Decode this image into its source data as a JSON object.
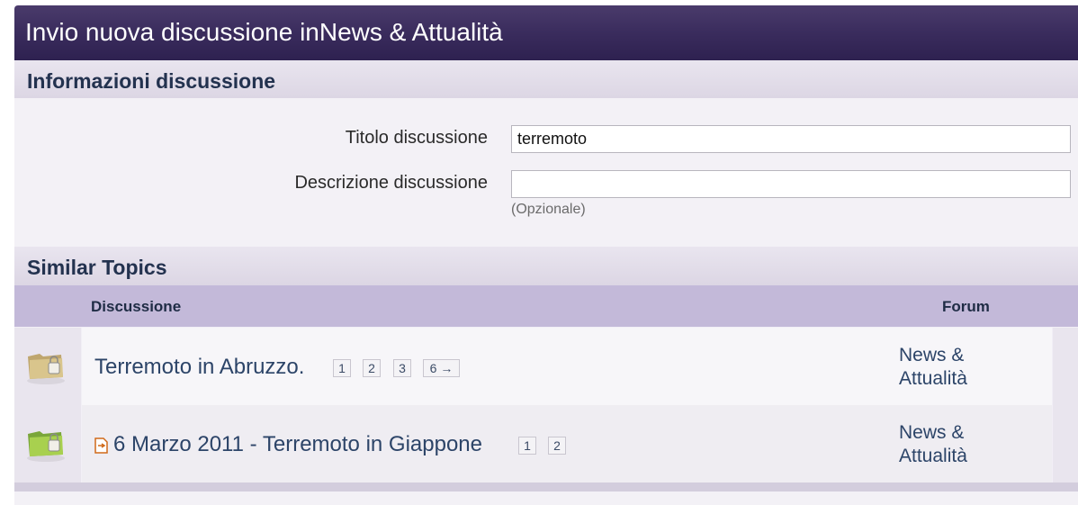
{
  "header": {
    "title": "Invio nuova discussione inNews & Attualità"
  },
  "info_section": {
    "title": "Informazioni discussione",
    "fields": {
      "title_label": "Titolo discussione",
      "title_value": "terremoto",
      "description_label": "Descrizione discussione",
      "description_value": "",
      "description_hint": "(Opzionale)"
    }
  },
  "similar_section": {
    "title": "Similar Topics",
    "columns": {
      "topic": "Discussione",
      "forum": "Forum"
    },
    "rows": [
      {
        "title": "Terremoto in Abruzzo.",
        "pages": [
          "1",
          "2",
          "3",
          "6 →"
        ],
        "forum_line1": "News &",
        "forum_line2": "Attualità",
        "icon": "folder-lock-icon",
        "has_attachment_icon": false
      },
      {
        "title": "6 Marzo 2011 - Terremoto in Giappone",
        "pages": [
          "1",
          "2"
        ],
        "forum_line1": "News &",
        "forum_line2": "Attualità",
        "icon": "folder-lock-icon",
        "has_attachment_icon": true
      }
    ]
  },
  "colors": {
    "header_bg": "#3a2c5d",
    "column_header_bg": "#c3b9d9",
    "link": "#2c4468"
  }
}
